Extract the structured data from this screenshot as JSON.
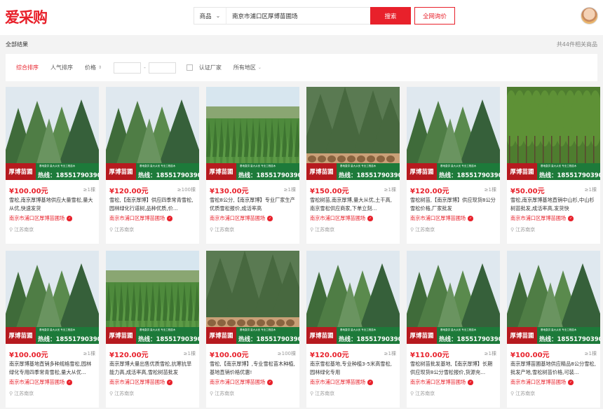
{
  "header": {
    "logo": "爱采购",
    "search_type": "商品",
    "search_query": "南京市浦口区厚博苗圃场",
    "search_button": "搜索",
    "inquiry_button": "全网询价"
  },
  "results": {
    "label": "全部结果",
    "count": "共44件相关商品"
  },
  "filters": {
    "sort_default": "综合排序",
    "sort_popular": "人气排序",
    "sort_price": "价格",
    "price_sep": "-",
    "certified": "认证厂家",
    "region": "所有地区"
  },
  "banner": {
    "label": "厚博苗圃",
    "hotline": "热线：18551790390",
    "tags": "基地直供 量大从优 专业工程苗木"
  },
  "products": [
    {
      "price": "¥100.00元",
      "moq": "≥1棵",
      "title": "雪松,南京厚博基地供应大量雪松,量大从优,快速发货",
      "shop": "南京市浦口区厚博苗圃场",
      "location": "江苏南京",
      "scene": "cedar"
    },
    {
      "price": "¥120.00元",
      "moq": "≥100棵",
      "title": "雪松,【南京厚博】供应四季常青雪松,园林绿化行道树,品种优质,价...",
      "shop": "南京市浦口区厚博苗圃场",
      "location": "江苏南京",
      "scene": "cedar"
    },
    {
      "price": "¥130.00元",
      "moq": "≥1棵",
      "title": "雪松8公分,【南京厚博】专业厂家生产优质雪松报价,成活率高",
      "shop": "南京市浦口区厚博苗圃场",
      "location": "江苏南京",
      "scene": "field"
    },
    {
      "price": "¥150.00元",
      "moq": "≥1棵",
      "title": "雪松树苗,南京厚博,量大从优,土干高,南京雪松供应商家,下单立刻...",
      "shop": "南京市浦口区厚博苗圃场",
      "location": "江苏南京",
      "scene": "rootball"
    },
    {
      "price": "¥120.00元",
      "moq": "≥1棵",
      "title": "雪松树苗,【南京厚博】供应现货8公分雪松价格,厂家批发",
      "shop": "南京市浦口区厚博苗圃场",
      "location": "江苏南京",
      "scene": "cedar"
    },
    {
      "price": "¥50.00元",
      "moq": "≥1棵",
      "title": "雪松,南京厚博基地直销中山杉,中山杉树苗批发,成活率高,发货快",
      "shop": "南京市浦口区厚博苗圃场",
      "location": "江苏南京",
      "scene": "deciduous"
    },
    {
      "price": "¥100.00元",
      "moq": "≥1棵",
      "title": "南京厚博基地直销多种规格雪松,园林绿化专用四季常青雪松,量大从优...",
      "shop": "南京市浦口区厚博苗圃场",
      "location": "江苏南京",
      "scene": "cedar"
    },
    {
      "price": "¥120.00元",
      "moq": "≥1棵",
      "title": "南京厚博大量出售优质雪松,抗寒抗旱能力高,成活率高,雪松树苗批发",
      "shop": "南京市浦口区厚博苗圃场",
      "location": "江苏南京",
      "scene": "field"
    },
    {
      "price": "¥100.00元",
      "moq": "≥100棵",
      "title": "雪松,【南京厚博】,专业雪松苗木种植,基地直销价格优惠!",
      "shop": "南京市浦口区厚博苗圃场",
      "location": "江苏南京",
      "scene": "rootball"
    },
    {
      "price": "¥120.00元",
      "moq": "≥1棵",
      "title": "南京雪松基地,专业种植3-5米高雪松,园林绿化专用",
      "shop": "南京市浦口区厚博苗圃场",
      "location": "江苏南京",
      "scene": "cedar"
    },
    {
      "price": "¥110.00元",
      "moq": "≥1棵",
      "title": "雪松树苗批发基地,【南京厚博】长期供应现货8公分雪松报价,货源充...",
      "shop": "南京市浦口区厚博苗圃场",
      "location": "江苏南京",
      "scene": "cedar"
    },
    {
      "price": "¥100.00元",
      "moq": "≥1棵",
      "title": "南京厚博苗圃基地供应精品8公分雪松,批发产地,雪松树苗价格,可装...",
      "shop": "南京市浦口区厚博苗圃场",
      "location": "江苏南京",
      "scene": "cedar"
    }
  ],
  "colors": {
    "accent": "#e8212b",
    "banner_green": "#1d7a3a",
    "banner_red": "#b61a1f"
  }
}
